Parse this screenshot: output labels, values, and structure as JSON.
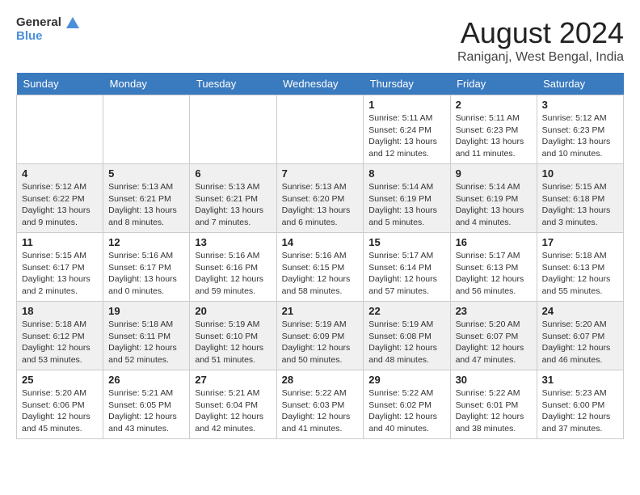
{
  "header": {
    "logo_line1": "General",
    "logo_line2": "Blue",
    "month_year": "August 2024",
    "location": "Raniganj, West Bengal, India"
  },
  "weekdays": [
    "Sunday",
    "Monday",
    "Tuesday",
    "Wednesday",
    "Thursday",
    "Friday",
    "Saturday"
  ],
  "weeks": [
    [
      {
        "day": "",
        "sunrise": "",
        "sunset": "",
        "daylight": ""
      },
      {
        "day": "",
        "sunrise": "",
        "sunset": "",
        "daylight": ""
      },
      {
        "day": "",
        "sunrise": "",
        "sunset": "",
        "daylight": ""
      },
      {
        "day": "",
        "sunrise": "",
        "sunset": "",
        "daylight": ""
      },
      {
        "day": "1",
        "sunrise": "Sunrise: 5:11 AM",
        "sunset": "Sunset: 6:24 PM",
        "daylight": "Daylight: 13 hours and 12 minutes."
      },
      {
        "day": "2",
        "sunrise": "Sunrise: 5:11 AM",
        "sunset": "Sunset: 6:23 PM",
        "daylight": "Daylight: 13 hours and 11 minutes."
      },
      {
        "day": "3",
        "sunrise": "Sunrise: 5:12 AM",
        "sunset": "Sunset: 6:23 PM",
        "daylight": "Daylight: 13 hours and 10 minutes."
      }
    ],
    [
      {
        "day": "4",
        "sunrise": "Sunrise: 5:12 AM",
        "sunset": "Sunset: 6:22 PM",
        "daylight": "Daylight: 13 hours and 9 minutes."
      },
      {
        "day": "5",
        "sunrise": "Sunrise: 5:13 AM",
        "sunset": "Sunset: 6:21 PM",
        "daylight": "Daylight: 13 hours and 8 minutes."
      },
      {
        "day": "6",
        "sunrise": "Sunrise: 5:13 AM",
        "sunset": "Sunset: 6:21 PM",
        "daylight": "Daylight: 13 hours and 7 minutes."
      },
      {
        "day": "7",
        "sunrise": "Sunrise: 5:13 AM",
        "sunset": "Sunset: 6:20 PM",
        "daylight": "Daylight: 13 hours and 6 minutes."
      },
      {
        "day": "8",
        "sunrise": "Sunrise: 5:14 AM",
        "sunset": "Sunset: 6:19 PM",
        "daylight": "Daylight: 13 hours and 5 minutes."
      },
      {
        "day": "9",
        "sunrise": "Sunrise: 5:14 AM",
        "sunset": "Sunset: 6:19 PM",
        "daylight": "Daylight: 13 hours and 4 minutes."
      },
      {
        "day": "10",
        "sunrise": "Sunrise: 5:15 AM",
        "sunset": "Sunset: 6:18 PM",
        "daylight": "Daylight: 13 hours and 3 minutes."
      }
    ],
    [
      {
        "day": "11",
        "sunrise": "Sunrise: 5:15 AM",
        "sunset": "Sunset: 6:17 PM",
        "daylight": "Daylight: 13 hours and 2 minutes."
      },
      {
        "day": "12",
        "sunrise": "Sunrise: 5:16 AM",
        "sunset": "Sunset: 6:17 PM",
        "daylight": "Daylight: 13 hours and 0 minutes."
      },
      {
        "day": "13",
        "sunrise": "Sunrise: 5:16 AM",
        "sunset": "Sunset: 6:16 PM",
        "daylight": "Daylight: 12 hours and 59 minutes."
      },
      {
        "day": "14",
        "sunrise": "Sunrise: 5:16 AM",
        "sunset": "Sunset: 6:15 PM",
        "daylight": "Daylight: 12 hours and 58 minutes."
      },
      {
        "day": "15",
        "sunrise": "Sunrise: 5:17 AM",
        "sunset": "Sunset: 6:14 PM",
        "daylight": "Daylight: 12 hours and 57 minutes."
      },
      {
        "day": "16",
        "sunrise": "Sunrise: 5:17 AM",
        "sunset": "Sunset: 6:13 PM",
        "daylight": "Daylight: 12 hours and 56 minutes."
      },
      {
        "day": "17",
        "sunrise": "Sunrise: 5:18 AM",
        "sunset": "Sunset: 6:13 PM",
        "daylight": "Daylight: 12 hours and 55 minutes."
      }
    ],
    [
      {
        "day": "18",
        "sunrise": "Sunrise: 5:18 AM",
        "sunset": "Sunset: 6:12 PM",
        "daylight": "Daylight: 12 hours and 53 minutes."
      },
      {
        "day": "19",
        "sunrise": "Sunrise: 5:18 AM",
        "sunset": "Sunset: 6:11 PM",
        "daylight": "Daylight: 12 hours and 52 minutes."
      },
      {
        "day": "20",
        "sunrise": "Sunrise: 5:19 AM",
        "sunset": "Sunset: 6:10 PM",
        "daylight": "Daylight: 12 hours and 51 minutes."
      },
      {
        "day": "21",
        "sunrise": "Sunrise: 5:19 AM",
        "sunset": "Sunset: 6:09 PM",
        "daylight": "Daylight: 12 hours and 50 minutes."
      },
      {
        "day": "22",
        "sunrise": "Sunrise: 5:19 AM",
        "sunset": "Sunset: 6:08 PM",
        "daylight": "Daylight: 12 hours and 48 minutes."
      },
      {
        "day": "23",
        "sunrise": "Sunrise: 5:20 AM",
        "sunset": "Sunset: 6:07 PM",
        "daylight": "Daylight: 12 hours and 47 minutes."
      },
      {
        "day": "24",
        "sunrise": "Sunrise: 5:20 AM",
        "sunset": "Sunset: 6:07 PM",
        "daylight": "Daylight: 12 hours and 46 minutes."
      }
    ],
    [
      {
        "day": "25",
        "sunrise": "Sunrise: 5:20 AM",
        "sunset": "Sunset: 6:06 PM",
        "daylight": "Daylight: 12 hours and 45 minutes."
      },
      {
        "day": "26",
        "sunrise": "Sunrise: 5:21 AM",
        "sunset": "Sunset: 6:05 PM",
        "daylight": "Daylight: 12 hours and 43 minutes."
      },
      {
        "day": "27",
        "sunrise": "Sunrise: 5:21 AM",
        "sunset": "Sunset: 6:04 PM",
        "daylight": "Daylight: 12 hours and 42 minutes."
      },
      {
        "day": "28",
        "sunrise": "Sunrise: 5:22 AM",
        "sunset": "Sunset: 6:03 PM",
        "daylight": "Daylight: 12 hours and 41 minutes."
      },
      {
        "day": "29",
        "sunrise": "Sunrise: 5:22 AM",
        "sunset": "Sunset: 6:02 PM",
        "daylight": "Daylight: 12 hours and 40 minutes."
      },
      {
        "day": "30",
        "sunrise": "Sunrise: 5:22 AM",
        "sunset": "Sunset: 6:01 PM",
        "daylight": "Daylight: 12 hours and 38 minutes."
      },
      {
        "day": "31",
        "sunrise": "Sunrise: 5:23 AM",
        "sunset": "Sunset: 6:00 PM",
        "daylight": "Daylight: 12 hours and 37 minutes."
      }
    ]
  ]
}
